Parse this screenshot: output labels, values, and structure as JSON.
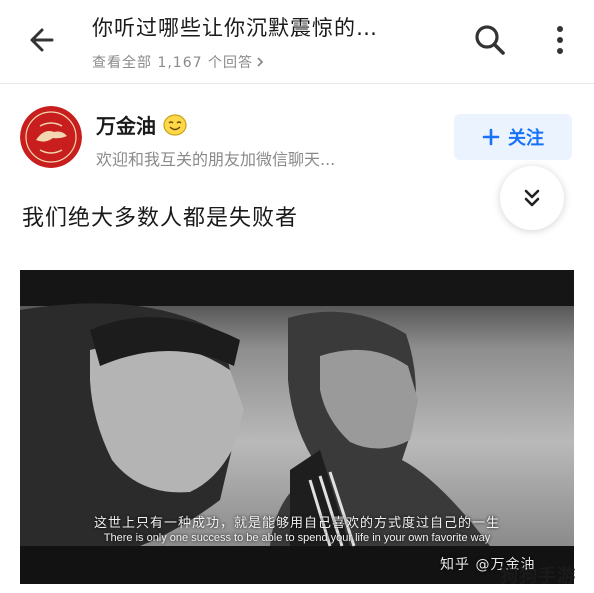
{
  "header": {
    "question_title": "你听过哪些让你沉默震惊的…",
    "view_all_answers": "查看全部 1,167 个回答",
    "back_icon": "arrow-left-icon",
    "search_icon": "search-icon",
    "more_icon": "more-vertical-icon"
  },
  "author": {
    "name": "万金油",
    "badge_icon": "smile-emoji-icon",
    "bio": "欢迎和我互关的朋友加微信聊天...",
    "follow_label": "关注",
    "follow_icon": "plus-icon",
    "accent_color": "#1772f6"
  },
  "collapse": {
    "icon": "double-chevron-down-icon"
  },
  "answer": {
    "text": "我们绝大多数人都是失败者",
    "image": {
      "caption_cn": "这世上只有一种成功，就是能够用自己喜欢的方式度过自己的一生",
      "caption_en": "There is only one success to be able to spend your life in your own favorite way",
      "watermark": "知乎 @万金油"
    }
  },
  "site_watermark": "狗狗手游"
}
